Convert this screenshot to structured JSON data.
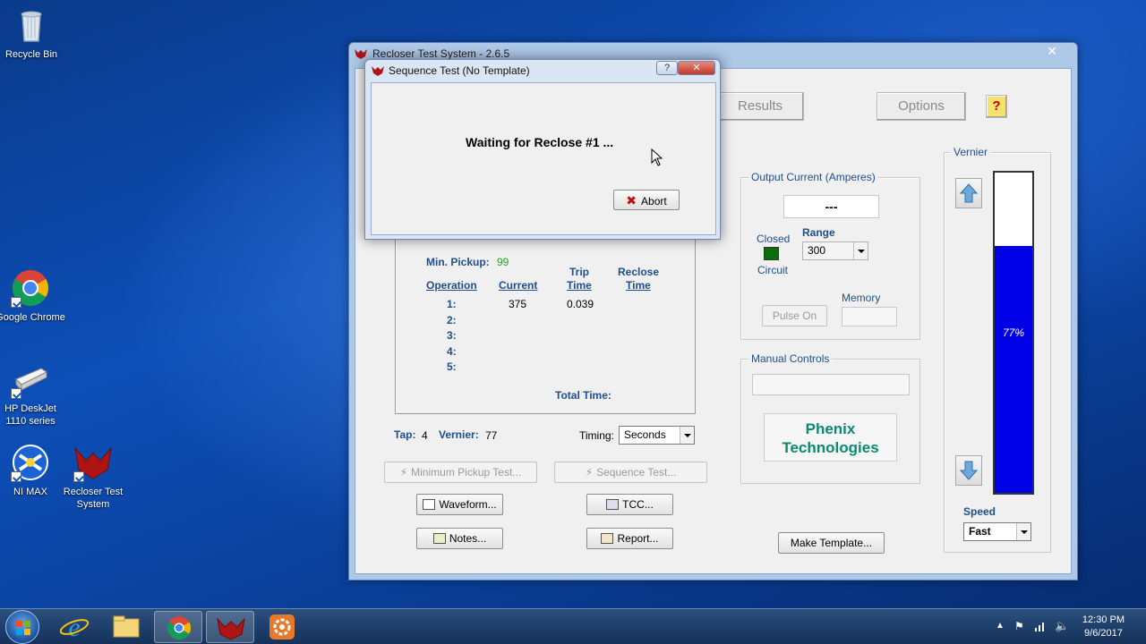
{
  "desktop": {
    "icons": [
      {
        "label": "Recycle Bin"
      },
      {
        "label": "Google Chrome"
      },
      {
        "label": "HP DeskJet 1110 series"
      },
      {
        "label": "NI MAX"
      },
      {
        "label": "Recloser Test System"
      }
    ]
  },
  "main_window": {
    "title": "Recloser Test System - 2.6.5",
    "close_glyph": "✕",
    "tabs": {
      "results": "Results",
      "options": "Options",
      "help": "?"
    },
    "results": {
      "min_pickup_label": "Min. Pickup:",
      "min_pickup_value": "99",
      "headers": {
        "operation": "Operation",
        "current": "Current",
        "trip_time_1": "Trip",
        "trip_time_2": "Time",
        "reclose_time_1": "Reclose",
        "reclose_time_2": "Time"
      },
      "rows": [
        {
          "op": "1:",
          "current": "375",
          "trip": "0.039"
        },
        {
          "op": "2:",
          "current": "",
          "trip": ""
        },
        {
          "op": "3:",
          "current": "",
          "trip": ""
        },
        {
          "op": "4:",
          "current": "",
          "trip": ""
        },
        {
          "op": "5:",
          "current": "",
          "trip": ""
        }
      ],
      "total_time_label": "Total Time:"
    },
    "tap_label": "Tap:",
    "tap_value": "4",
    "vernier_label": "Vernier:",
    "vernier_value": "77",
    "timing_label": "Timing:",
    "timing_value": "Seconds",
    "buttons": {
      "min_pickup_test": "Minimum Pickup Test...",
      "sequence_test": "Sequence Test...",
      "waveform": "Waveform...",
      "tcc": "TCC...",
      "notes": "Notes...",
      "report": "Report...",
      "make_template": "Make Template..."
    },
    "output_current": {
      "group_label": "Output Current (Amperes)",
      "display": "---",
      "closed_label": "Closed",
      "circuit_label": "Circuit",
      "range_label": "Range",
      "range_value": "300",
      "pulse_on": "Pulse On",
      "memory_label": "Memory"
    },
    "manual_controls": {
      "group_label": "Manual Controls",
      "brand_line1": "Phenix",
      "brand_line2": "Technologies"
    },
    "vernier": {
      "group_label": "Vernier",
      "percent_text": "77%",
      "level": 0.77,
      "speed_label": "Speed",
      "speed_value": "Fast"
    },
    "colors": {
      "indicator": "#0a6e0a",
      "vernier_fill": "#0000e6",
      "min_pickup": "#2ea02e",
      "brand": "#0a8a6e"
    }
  },
  "dialog": {
    "title": "Sequence Test (No Template)",
    "message": "Waiting for Reclose #1 ...",
    "abort": "Abort",
    "help_glyph": "?",
    "close_glyph": "✕"
  },
  "taskbar": {
    "time": "12:30 PM",
    "date": "9/6/2017"
  }
}
